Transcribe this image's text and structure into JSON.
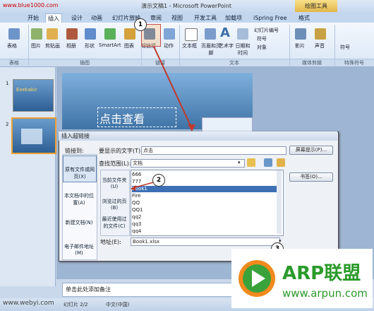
{
  "titlebar": {
    "title": "演示文稿1 - Microsoft PowerPoint",
    "drawing_tools": "绘图工具",
    "watermark_top": "www.blue1000.com"
  },
  "tabs": [
    "开始",
    "插入",
    "设计",
    "动画",
    "幻灯片放映",
    "审阅",
    "视图",
    "开发工具",
    "加载项",
    "iSpring Free",
    "格式"
  ],
  "ribbon": {
    "buttons": [
      "表格",
      "图片",
      "剪贴画",
      "相册",
      "形状",
      "SmartArt",
      "图表",
      "超链接",
      "动作",
      "文本框",
      "页眉和页脚",
      "艺术字",
      "日期和时间",
      "幻灯片编号",
      "符号",
      "对象",
      "影片",
      "声音",
      "符号"
    ],
    "groups": [
      "表格",
      "插图",
      "链接",
      "文本",
      "媒体剪辑",
      "特殊符号"
    ]
  },
  "slide": {
    "title_placeholder": "点击查看"
  },
  "thumbs": {
    "one": "1",
    "two": "2",
    "thumb_label": "Exekakir"
  },
  "dialog": {
    "title": "插入超链接",
    "link_to_label": "链接到:",
    "display_text_label": "要显示的文字(T):",
    "display_text_value": "点击",
    "screen_tip": "屏幕提示(P)...",
    "lookin_label": "查找范围(L):",
    "lookin_value": "文档",
    "nav": [
      "原有文件或网页(X)",
      "本文档中的位置(A)",
      "新建文档(N)",
      "电子邮件地址(M)"
    ],
    "sub_nav": [
      "当前文件夹(U)",
      "浏览过的页(B)",
      "最近使用过的文件(C)"
    ],
    "files": [
      "666",
      "777",
      "Book1",
      "Fire",
      "QQ",
      "QQ1",
      "qq2",
      "qq3",
      "qq4"
    ],
    "bookmark": "书签(O)...",
    "address_label": "地址(E):",
    "address_value": "Book1.xlsx"
  },
  "callouts": [
    "1",
    "2",
    "3"
  ],
  "notes": {
    "placeholder": "单击此处添加备注"
  },
  "status": {
    "left": "幻灯片 2/2",
    "lang": "中文(中国)",
    "watermark_bottom": "www.webyi.com"
  },
  "logo": {
    "brand": "ARP联盟",
    "url": "www.arpun.com"
  },
  "colors": {
    "accent": "#c0392b",
    "logo_green": "#3aa23a",
    "logo_orange": "#f08a1c"
  }
}
